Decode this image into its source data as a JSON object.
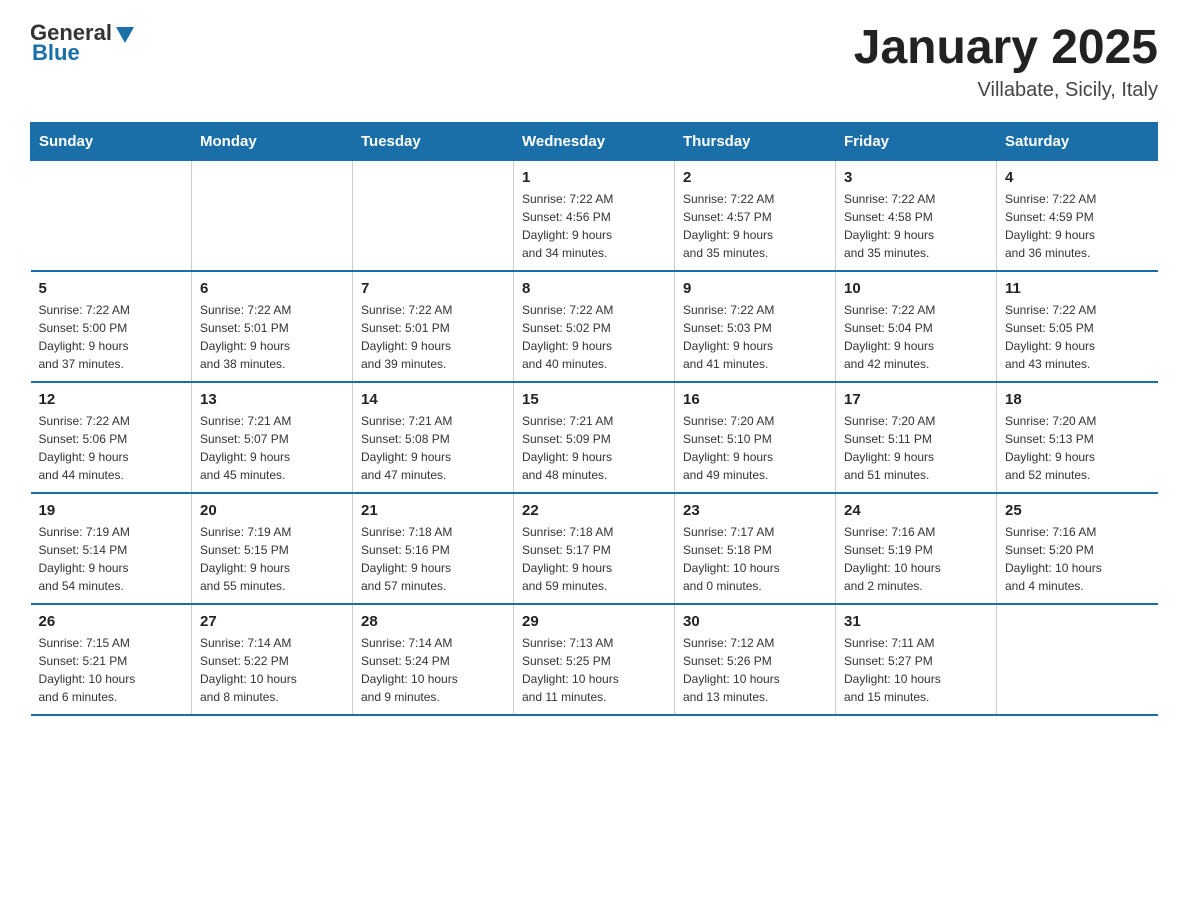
{
  "header": {
    "logo_general": "General",
    "logo_blue": "Blue",
    "title": "January 2025",
    "subtitle": "Villabate, Sicily, Italy"
  },
  "weekdays": [
    "Sunday",
    "Monday",
    "Tuesday",
    "Wednesday",
    "Thursday",
    "Friday",
    "Saturday"
  ],
  "weeks": [
    [
      {
        "day": "",
        "info": ""
      },
      {
        "day": "",
        "info": ""
      },
      {
        "day": "",
        "info": ""
      },
      {
        "day": "1",
        "info": "Sunrise: 7:22 AM\nSunset: 4:56 PM\nDaylight: 9 hours\nand 34 minutes."
      },
      {
        "day": "2",
        "info": "Sunrise: 7:22 AM\nSunset: 4:57 PM\nDaylight: 9 hours\nand 35 minutes."
      },
      {
        "day": "3",
        "info": "Sunrise: 7:22 AM\nSunset: 4:58 PM\nDaylight: 9 hours\nand 35 minutes."
      },
      {
        "day": "4",
        "info": "Sunrise: 7:22 AM\nSunset: 4:59 PM\nDaylight: 9 hours\nand 36 minutes."
      }
    ],
    [
      {
        "day": "5",
        "info": "Sunrise: 7:22 AM\nSunset: 5:00 PM\nDaylight: 9 hours\nand 37 minutes."
      },
      {
        "day": "6",
        "info": "Sunrise: 7:22 AM\nSunset: 5:01 PM\nDaylight: 9 hours\nand 38 minutes."
      },
      {
        "day": "7",
        "info": "Sunrise: 7:22 AM\nSunset: 5:01 PM\nDaylight: 9 hours\nand 39 minutes."
      },
      {
        "day": "8",
        "info": "Sunrise: 7:22 AM\nSunset: 5:02 PM\nDaylight: 9 hours\nand 40 minutes."
      },
      {
        "day": "9",
        "info": "Sunrise: 7:22 AM\nSunset: 5:03 PM\nDaylight: 9 hours\nand 41 minutes."
      },
      {
        "day": "10",
        "info": "Sunrise: 7:22 AM\nSunset: 5:04 PM\nDaylight: 9 hours\nand 42 minutes."
      },
      {
        "day": "11",
        "info": "Sunrise: 7:22 AM\nSunset: 5:05 PM\nDaylight: 9 hours\nand 43 minutes."
      }
    ],
    [
      {
        "day": "12",
        "info": "Sunrise: 7:22 AM\nSunset: 5:06 PM\nDaylight: 9 hours\nand 44 minutes."
      },
      {
        "day": "13",
        "info": "Sunrise: 7:21 AM\nSunset: 5:07 PM\nDaylight: 9 hours\nand 45 minutes."
      },
      {
        "day": "14",
        "info": "Sunrise: 7:21 AM\nSunset: 5:08 PM\nDaylight: 9 hours\nand 47 minutes."
      },
      {
        "day": "15",
        "info": "Sunrise: 7:21 AM\nSunset: 5:09 PM\nDaylight: 9 hours\nand 48 minutes."
      },
      {
        "day": "16",
        "info": "Sunrise: 7:20 AM\nSunset: 5:10 PM\nDaylight: 9 hours\nand 49 minutes."
      },
      {
        "day": "17",
        "info": "Sunrise: 7:20 AM\nSunset: 5:11 PM\nDaylight: 9 hours\nand 51 minutes."
      },
      {
        "day": "18",
        "info": "Sunrise: 7:20 AM\nSunset: 5:13 PM\nDaylight: 9 hours\nand 52 minutes."
      }
    ],
    [
      {
        "day": "19",
        "info": "Sunrise: 7:19 AM\nSunset: 5:14 PM\nDaylight: 9 hours\nand 54 minutes."
      },
      {
        "day": "20",
        "info": "Sunrise: 7:19 AM\nSunset: 5:15 PM\nDaylight: 9 hours\nand 55 minutes."
      },
      {
        "day": "21",
        "info": "Sunrise: 7:18 AM\nSunset: 5:16 PM\nDaylight: 9 hours\nand 57 minutes."
      },
      {
        "day": "22",
        "info": "Sunrise: 7:18 AM\nSunset: 5:17 PM\nDaylight: 9 hours\nand 59 minutes."
      },
      {
        "day": "23",
        "info": "Sunrise: 7:17 AM\nSunset: 5:18 PM\nDaylight: 10 hours\nand 0 minutes."
      },
      {
        "day": "24",
        "info": "Sunrise: 7:16 AM\nSunset: 5:19 PM\nDaylight: 10 hours\nand 2 minutes."
      },
      {
        "day": "25",
        "info": "Sunrise: 7:16 AM\nSunset: 5:20 PM\nDaylight: 10 hours\nand 4 minutes."
      }
    ],
    [
      {
        "day": "26",
        "info": "Sunrise: 7:15 AM\nSunset: 5:21 PM\nDaylight: 10 hours\nand 6 minutes."
      },
      {
        "day": "27",
        "info": "Sunrise: 7:14 AM\nSunset: 5:22 PM\nDaylight: 10 hours\nand 8 minutes."
      },
      {
        "day": "28",
        "info": "Sunrise: 7:14 AM\nSunset: 5:24 PM\nDaylight: 10 hours\nand 9 minutes."
      },
      {
        "day": "29",
        "info": "Sunrise: 7:13 AM\nSunset: 5:25 PM\nDaylight: 10 hours\nand 11 minutes."
      },
      {
        "day": "30",
        "info": "Sunrise: 7:12 AM\nSunset: 5:26 PM\nDaylight: 10 hours\nand 13 minutes."
      },
      {
        "day": "31",
        "info": "Sunrise: 7:11 AM\nSunset: 5:27 PM\nDaylight: 10 hours\nand 15 minutes."
      },
      {
        "day": "",
        "info": ""
      }
    ]
  ]
}
